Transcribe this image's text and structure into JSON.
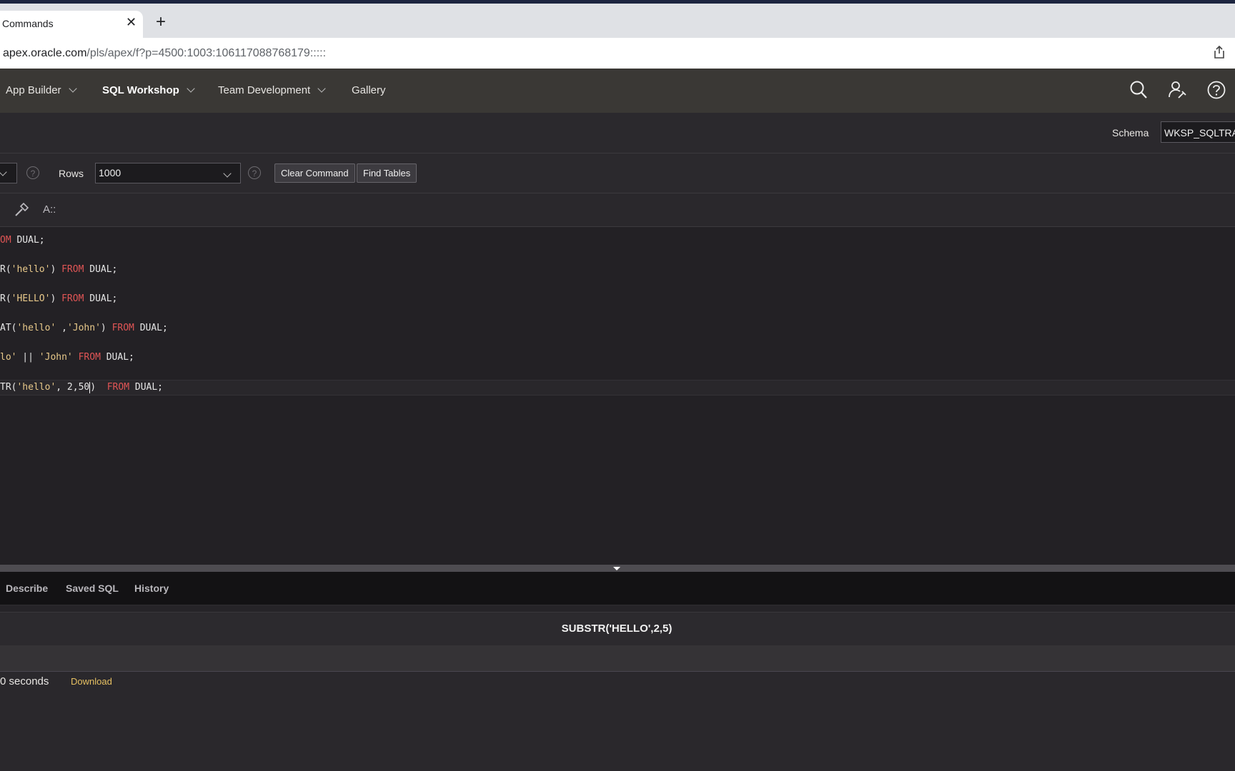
{
  "browser": {
    "tab_title": "Commands",
    "close_glyph": "✕",
    "new_tab_glyph": "+",
    "url_host": "apex.oracle.com",
    "url_path": "/pls/apex/f?p=4500:1003:106117088768179:::::"
  },
  "nav": {
    "items": [
      {
        "label": "App Builder"
      },
      {
        "label": "SQL Workshop"
      },
      {
        "label": "Team Development"
      },
      {
        "label": "Gallery"
      }
    ],
    "icons": [
      "search-icon",
      "user-wrench-icon",
      "help-icon"
    ]
  },
  "schema": {
    "label": "Schema",
    "value": "WKSP_SQLTRAII"
  },
  "toolbar": {
    "help_glyph": "?",
    "rows_label": "Rows",
    "rows_value": "1000",
    "clear_command_label": "Clear Command",
    "find_tables_label": "Find Tables"
  },
  "editor_tools": {
    "font_label": "A::"
  },
  "editor": {
    "lines": [
      [
        {
          "t": "OM",
          "c": "kw"
        },
        {
          "t": " DUAL;",
          "c": "pl"
        }
      ],
      [
        {
          "t": "R(",
          "c": "pl"
        },
        {
          "t": "'hello'",
          "c": "str"
        },
        {
          "t": ") ",
          "c": "pl"
        },
        {
          "t": "FROM",
          "c": "kw"
        },
        {
          "t": " DUAL;",
          "c": "pl"
        }
      ],
      [
        {
          "t": "R(",
          "c": "pl"
        },
        {
          "t": "'HELLO'",
          "c": "str"
        },
        {
          "t": ") ",
          "c": "pl"
        },
        {
          "t": "FROM",
          "c": "kw"
        },
        {
          "t": " DUAL;",
          "c": "pl"
        }
      ],
      [
        {
          "t": "AT(",
          "c": "pl"
        },
        {
          "t": "'hello'",
          "c": "str"
        },
        {
          "t": " ,",
          "c": "pl"
        },
        {
          "t": "'John'",
          "c": "str"
        },
        {
          "t": ") ",
          "c": "pl"
        },
        {
          "t": "FROM",
          "c": "kw"
        },
        {
          "t": " DUAL;",
          "c": "pl"
        }
      ],
      [
        {
          "t": "lo'",
          "c": "str"
        },
        {
          "t": " || ",
          "c": "pl"
        },
        {
          "t": "'John'",
          "c": "str"
        },
        {
          "t": " ",
          "c": "pl"
        },
        {
          "t": "FROM",
          "c": "kw"
        },
        {
          "t": " DUAL;",
          "c": "pl"
        }
      ],
      [
        {
          "t": "TR(",
          "c": "pl"
        },
        {
          "t": "'hello'",
          "c": "str"
        },
        {
          "t": ", 2,50",
          "c": "pl"
        },
        {
          "t": "|",
          "c": "cursor"
        },
        {
          "t": ")  ",
          "c": "pl"
        },
        {
          "t": "FROM",
          "c": "kw"
        },
        {
          "t": " DUAL;",
          "c": "pl"
        }
      ]
    ]
  },
  "results": {
    "tabs": [
      {
        "label": "Describe"
      },
      {
        "label": "Saved SQL"
      },
      {
        "label": "History"
      }
    ],
    "column_header": "SUBSTR('HELLO',2,5)",
    "timing": "0 seconds",
    "download_label": "Download"
  }
}
